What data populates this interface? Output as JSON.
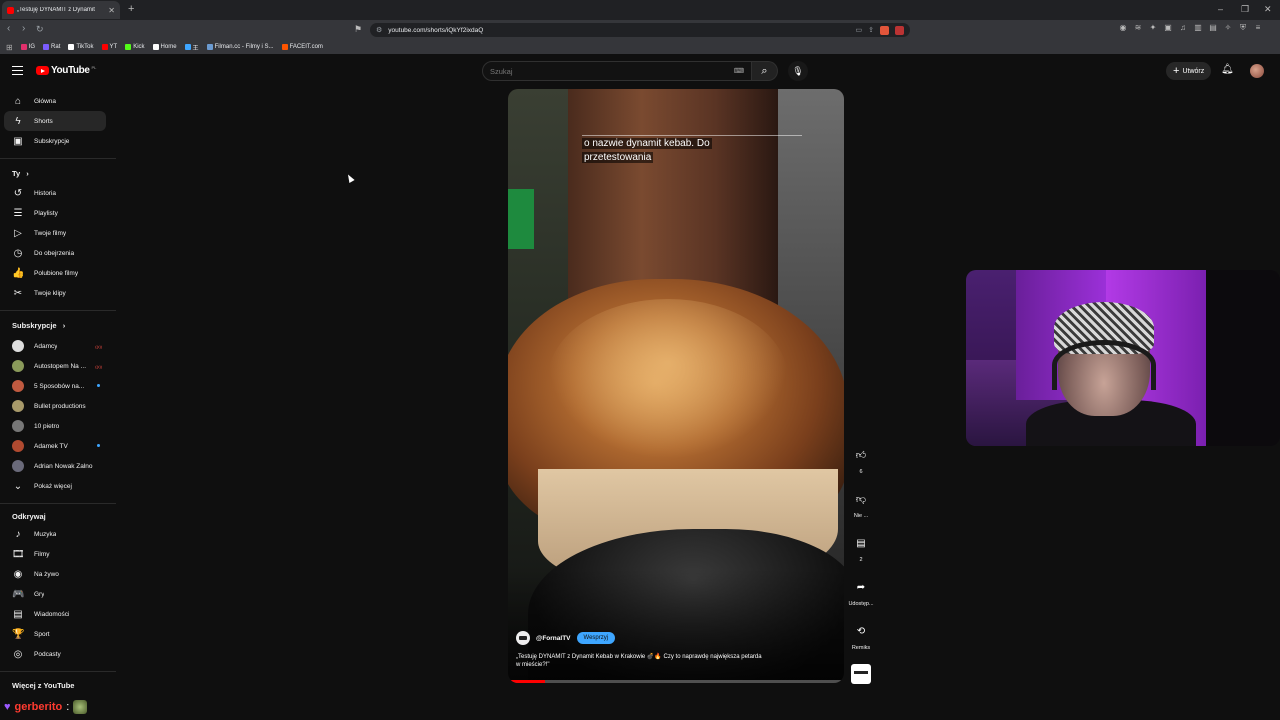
{
  "browser": {
    "tab_title": "„Testuję DYNAMIT z Dynamit",
    "new_tab": "+",
    "window_controls": [
      "–",
      "❐",
      "✕"
    ],
    "url": "youtube.com/shorts/iQkYf2ixdaQ",
    "bookmarks": [
      {
        "label": "IG",
        "color": "#e1306c"
      },
      {
        "label": "Rat",
        "color": "#7b5cff"
      },
      {
        "label": "TikTok",
        "color": "#ffffff"
      },
      {
        "label": "YT",
        "color": "#ff0000"
      },
      {
        "label": "Kick",
        "color": "#53fc18"
      },
      {
        "label": "Home",
        "color": "#ffffff"
      },
      {
        "label": "王",
        "color": "#3ea6ff"
      },
      {
        "label": "Filman.cc - Filmy i S...",
        "color": "#6b9bd1"
      },
      {
        "label": "FACEIT.com",
        "color": "#ff5500"
      }
    ]
  },
  "header": {
    "logo_text": "YouTube",
    "logo_country": "PL",
    "search_placeholder": "Szukaj",
    "create_label": "Utwórz"
  },
  "sidebar": {
    "main": [
      {
        "label": "Główna",
        "icon": "home-icon",
        "glyph": "⌂"
      },
      {
        "label": "Shorts",
        "icon": "shorts-icon",
        "glyph": "ϟ"
      },
      {
        "label": "Subskrypcje",
        "icon": "subscriptions-icon",
        "glyph": "▣"
      }
    ],
    "you_heading": "Ty",
    "you": [
      {
        "label": "Historia",
        "icon": "history-icon",
        "glyph": "↺"
      },
      {
        "label": "Playlisty",
        "icon": "playlists-icon",
        "glyph": "☰"
      },
      {
        "label": "Twoje filmy",
        "icon": "your-videos-icon",
        "glyph": "▷"
      },
      {
        "label": "Do obejrzenia",
        "icon": "watch-later-icon",
        "glyph": "◷"
      },
      {
        "label": "Polubione filmy",
        "icon": "liked-icon",
        "glyph": "👍"
      },
      {
        "label": "Twoje klipy",
        "icon": "clips-icon",
        "glyph": "✂"
      }
    ],
    "subs_heading": "Subskrypcje",
    "subs": [
      {
        "label": "Adamcy",
        "color": "#ddd",
        "badge": "live"
      },
      {
        "label": "Autostopem Na ...",
        "color": "#8a9a5a",
        "badge": "live"
      },
      {
        "label": "5 Sposobów na...",
        "color": "#c05a40",
        "badge": "dot"
      },
      {
        "label": "Bullet productions",
        "color": "#a89a6a",
        "badge": ""
      },
      {
        "label": "10 pietro",
        "color": "#777",
        "badge": ""
      },
      {
        "label": "Adamek TV",
        "color": "#b04a30",
        "badge": "dot"
      },
      {
        "label": "Adrian Nowak Zalno",
        "color": "#6a6a7a",
        "badge": ""
      }
    ],
    "show_more": "Pokaż więcej",
    "explore_heading": "Odkrywaj",
    "explore": [
      {
        "label": "Muzyka",
        "icon": "music-icon",
        "glyph": "♪"
      },
      {
        "label": "Filmy",
        "icon": "movies-icon",
        "glyph": "🎞"
      },
      {
        "label": "Na żywo",
        "icon": "live-icon",
        "glyph": "◉"
      },
      {
        "label": "Gry",
        "icon": "gaming-icon",
        "glyph": "🎮"
      },
      {
        "label": "Wiadomości",
        "icon": "news-icon",
        "glyph": "▤"
      },
      {
        "label": "Sport",
        "icon": "sport-icon",
        "glyph": "🏆"
      },
      {
        "label": "Podcasty",
        "icon": "podcasts-icon",
        "glyph": "◎"
      }
    ],
    "more_heading": "Więcej z YouTube"
  },
  "short": {
    "caption_line1": "o nazwie dynamit kebab. Do",
    "caption_line2": "przetestowania",
    "channel": "@FornalTV",
    "support_label": "Wesprzyj",
    "title": "„Testuję DYNAMIT z Dynamit Kebab w Krakowie 💣🔥 Czy to naprawdę największa petarda w mieście?!\"",
    "progress_fraction": 0.11
  },
  "actions": {
    "like_count": "6",
    "dislike_label": "Nie ...",
    "comment_count": "2",
    "share_label": "Udostęp...",
    "remix_label": "Remiks"
  },
  "overlay": {
    "chat_user": "gerberito",
    "chat_colon": ":"
  }
}
